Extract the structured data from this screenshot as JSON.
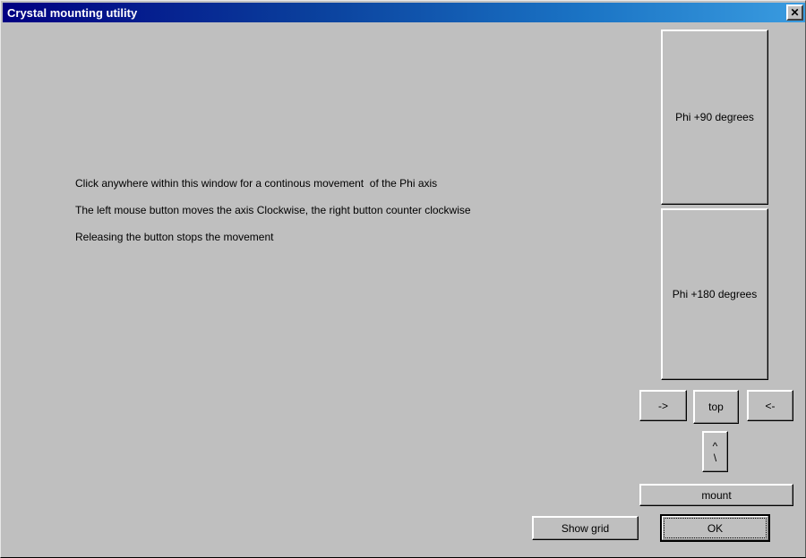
{
  "window": {
    "title": "Crystal mounting utility",
    "close_icon": "close-icon",
    "close_label": "✕"
  },
  "colors": {
    "face": "#bfbfbf",
    "title_gradient_start": "#000082",
    "title_gradient_end": "#3a9ce0",
    "title_text": "#ffffff",
    "body_text": "#000000",
    "highlight": "#ffffff",
    "shadow": "#000000"
  },
  "instructions": [
    "Click anywhere within this window for a continous movement  of the Phi axis",
    "The left mouse button moves the axis Clockwise, the right button counter clockwise",
    "Releasing the button stops the movement"
  ],
  "buttons": {
    "phi90": "Phi +90 degrees",
    "phi180": "Phi +180 degrees",
    "right_arrow": "->",
    "top": "top",
    "left_arrow": "<-",
    "diag_line1": "^",
    "diag_line2": "\\",
    "mount": "mount",
    "show_grid": "Show grid",
    "ok": "OK"
  }
}
